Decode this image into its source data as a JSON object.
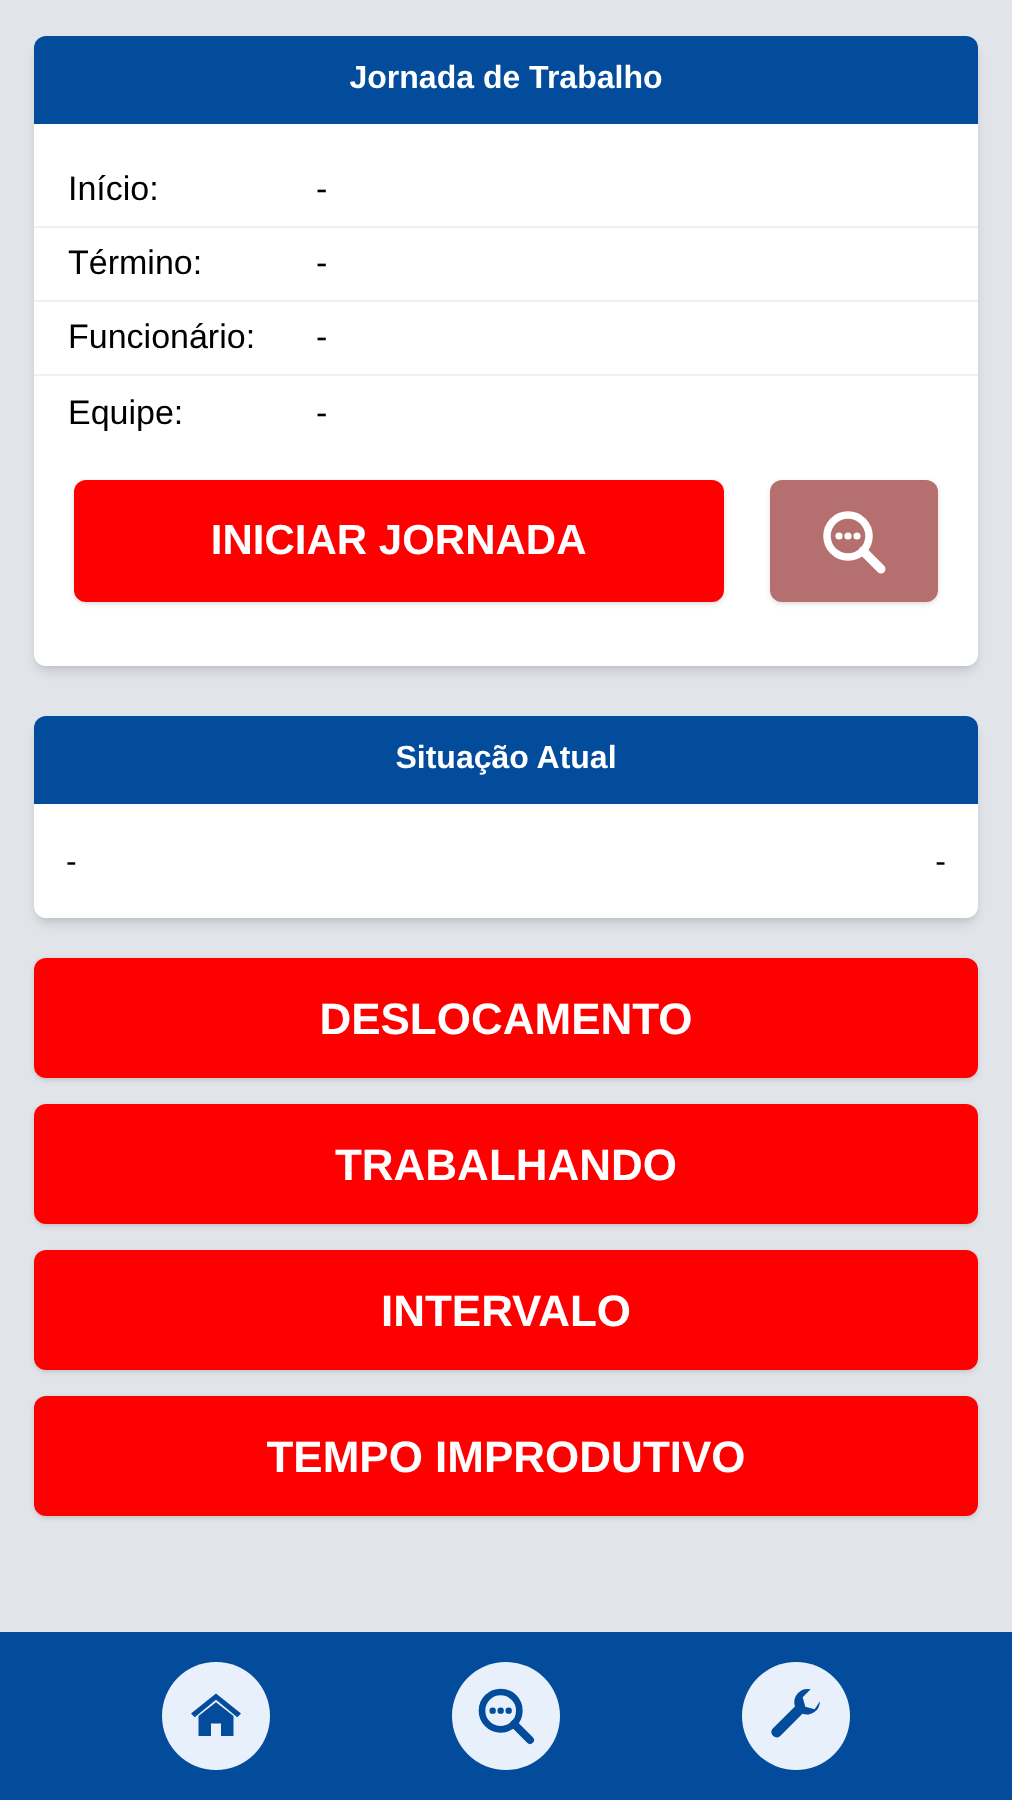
{
  "journey_card": {
    "title": "Jornada de Trabalho",
    "fields": [
      {
        "label": "Início:",
        "value": "-"
      },
      {
        "label": "Término:",
        "value": "-"
      },
      {
        "label": "Funcionário:",
        "value": "-"
      },
      {
        "label": "Equipe:",
        "value": "-"
      }
    ],
    "start_button": "INICIAR JORNADA",
    "search_button": {
      "disabled": true
    }
  },
  "status_card": {
    "title": "Situação Atual",
    "left": "-",
    "right": "-"
  },
  "actions": [
    "DESLOCAMENTO",
    "TRABALHANDO",
    "INTERVALO",
    "TEMPO IMPRODUTIVO"
  ],
  "nav": [
    {
      "kind": "home"
    },
    {
      "kind": "search"
    },
    {
      "kind": "settings"
    }
  ]
}
